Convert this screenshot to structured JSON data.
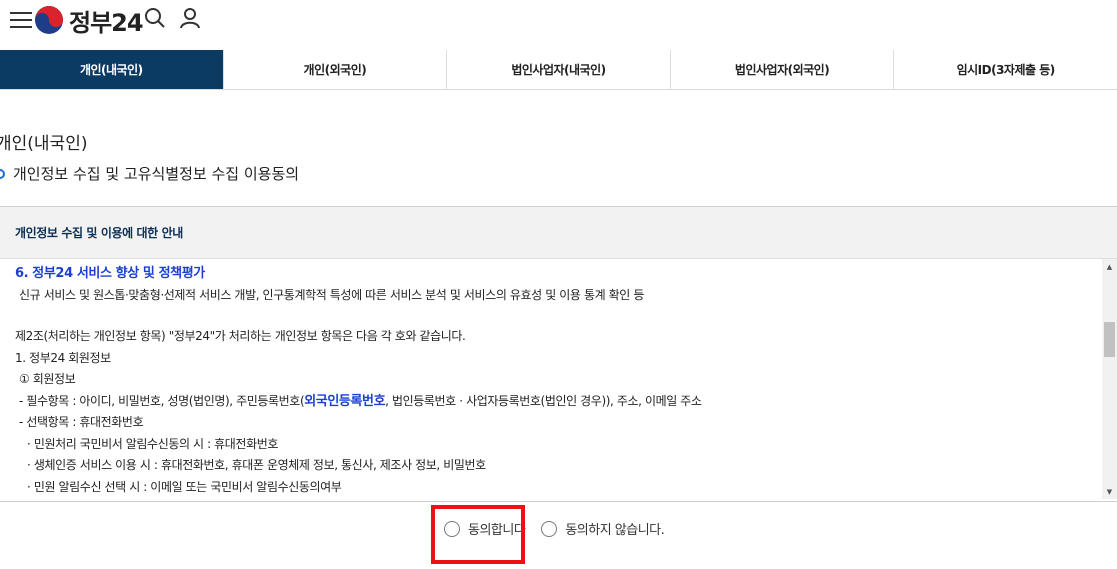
{
  "header": {
    "menu_icon": "hamburger-menu-icon",
    "logo_text": "정부24",
    "search_icon": "search-icon",
    "user_icon": "user-icon"
  },
  "tabs": [
    {
      "label": "개인(내국인)",
      "active": true
    },
    {
      "label": "개인(외국인)",
      "active": false
    },
    {
      "label": "법인사업자(내국인)",
      "active": false
    },
    {
      "label": "법인사업자(외국인)",
      "active": false
    },
    {
      "label": "임시ID(3자제출 등)",
      "active": false
    }
  ],
  "page": {
    "title": "개인(내국인)",
    "section_title": "개인정보 수집 및 고유식별정보 수집 이용동의"
  },
  "notice": {
    "heading": "개인정보 수집 및 이용에 대한 안내",
    "lines": {
      "l1": "6. 정부24 서비스 향상 및 정책평가",
      "l2": "신규 서비스 및 원스톱·맞춤형·선제적 서비스 개발, 인구통계학적 특성에 따른 서비스 분석 및 서비스의 유효성 및 이용 통계 확인 등",
      "l3": "제2조(처리하는 개인정보 항목) \"정부24\"가 처리하는 개인정보 항목은 다음 각 호와 같습니다.",
      "l4": "1. 정부24 회원정보",
      "l5": "① 회원정보",
      "l6a": "- 필수항목 : 아이디, 비밀번호, 성명(법인명), 주민등록번호(",
      "l6b": "외국인등록번호",
      "l6c": ", 법인등록번호 · 사업자등록번호(법인인 경우)), 주소, 이메일 주소",
      "l7": "- 선택항목 : 휴대전화번호",
      "l8": "· 민원처리 국민비서 알림수신동의 시 : 휴대전화번호",
      "l9": "· 생체인증 서비스 이용 시 : 휴대전화번호, 휴대폰 운영체제 정보, 통신사, 제조사 정보, 비밀번호",
      "l10": "· 민원 알림수신 선택 시 : 이메일 또는 국민비서 알림수신동의여부"
    }
  },
  "consent": {
    "agree_label": "동의합니다",
    "disagree_label": "동의하지 않습니다."
  },
  "colors": {
    "active_tab": "#0b3a63",
    "link_blue": "#1b3fd1",
    "highlight_red": "#ee1111"
  }
}
